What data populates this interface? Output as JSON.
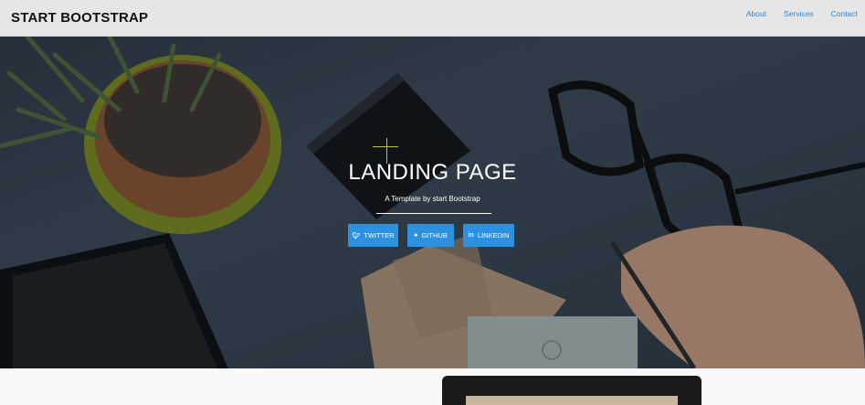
{
  "navbar": {
    "brand": "START BOOTSTRAP",
    "links": [
      "About",
      "Services",
      "Contact"
    ]
  },
  "hero": {
    "title": "LANDING PAGE",
    "subtitle": "A Template by start Bootstrap",
    "buttons": [
      {
        "label": "TWITTER",
        "icon": "twitter-icon"
      },
      {
        "label": "GITHUB",
        "icon": "github-icon"
      },
      {
        "label": "LINKEDIN",
        "icon": "linkedin-icon"
      }
    ]
  },
  "colors": {
    "navbar_bg": "#e6e6e6",
    "link": "#2f89d1",
    "button": "#2c92e0",
    "accent_cross": "#c8c13a"
  }
}
